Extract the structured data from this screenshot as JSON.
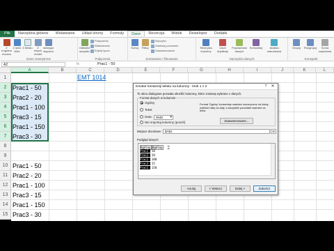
{
  "ribbon_tabs": [
    "Plik",
    "Narzędzia główne",
    "Wstawianie",
    "Układ strony",
    "Formuły",
    "Dane",
    "Recenzja",
    "Widok",
    "Deweloper",
    "Dodatki"
  ],
  "ribbon_groups": [
    {
      "label": "Dane zewnętrzne",
      "buttons": [
        "Z programu Access",
        "Z sieci Web",
        "Z tekstu",
        "Z innych źródeł",
        "Istniejące połączenia"
      ]
    },
    {
      "label": "Połączenia",
      "buttons": [
        "Odśwież wszystko"
      ],
      "small": [
        "Połączenia",
        "Właściwości",
        "Edytuj łącza"
      ]
    },
    {
      "label": "Sortowanie i filtrowanie",
      "buttons": [
        "Sortuj",
        "Filtruj"
      ],
      "small": [
        "Wyczyść",
        "Zastosuj ponownie",
        "Zaawansowane"
      ]
    },
    {
      "label": "Narzędzia danych",
      "buttons": [
        "Tekst jako kolumny",
        "Usuń duplikaty",
        "Poprawność danych",
        "Konsoliduj",
        "Analiza warunkowa"
      ]
    },
    {
      "label": "Konspekt",
      "buttons": [
        "Grupuj",
        "Rozgrupuj",
        "Suma częściowa"
      ]
    }
  ],
  "formula_bar": {
    "name_box": "A2",
    "fx": "fx",
    "value": "Prac1 - 50"
  },
  "columns": [
    "A",
    "B",
    "C",
    "D",
    "E",
    "F",
    "G",
    "H",
    "I",
    "J",
    "K",
    "L"
  ],
  "rows": [
    "1",
    "2",
    "3",
    "4",
    "5",
    "6",
    "7",
    "8",
    "9",
    "10",
    "11",
    "12",
    "13",
    "14",
    "15"
  ],
  "selected_column": "A",
  "cells": {
    "A2": "Prac1 - 50",
    "A3": "Prac2 - 20",
    "A4": "Prac1 - 100",
    "A5": "Prac3 - 15",
    "A6": "Prac1 - 150",
    "A7": "Prac3 - 30",
    "A10": "Prac1 - 50",
    "A11": "Prac2 - 20",
    "A12": "Prac1 - 100",
    "A13": "Prac3 - 15",
    "A14": "Prac1 - 150",
    "A15": "Prac3 - 30",
    "C1_link": "EMT 1014"
  },
  "dialog": {
    "title": "Kreator konwersji tekstu na kolumny - krok 1 z 3",
    "help": "?",
    "close": "✕",
    "intro": "To okno dialogowe pozwala określić kolumny, które zostaną wybrane z danych.",
    "format_label": "Format danych w kolumnie",
    "radio_general": "Ogólny",
    "radio_text": "Tekst",
    "radio_date": "Data:",
    "date_format": "RMD",
    "radio_skip": "Nie importuj kolumny (pomiń)",
    "description": "Format 'Ogólny' konwertuje wartości numeryczne na liczby, wartości daty na daty, a wszystkie pozostałe wartości na tekst.",
    "advanced_button": "Zaawansowane...",
    "destination_label": "Miejsce docelowe:",
    "destination_value": "$A$2",
    "preview_label": "Podgląd danych",
    "preview_header": [
      "Ogólny",
      "Ogólny"
    ],
    "preview_rows": [
      [
        "Prac1",
        "50"
      ],
      [
        "Prac2",
        "20"
      ],
      [
        "Prac1",
        "100"
      ],
      [
        "Prac3",
        "15"
      ],
      [
        "Prac1",
        "150"
      ]
    ],
    "buttons": {
      "cancel": "Anuluj",
      "back": "< Wstecz",
      "next": "Dalej >",
      "finish": "Zakończ"
    }
  }
}
